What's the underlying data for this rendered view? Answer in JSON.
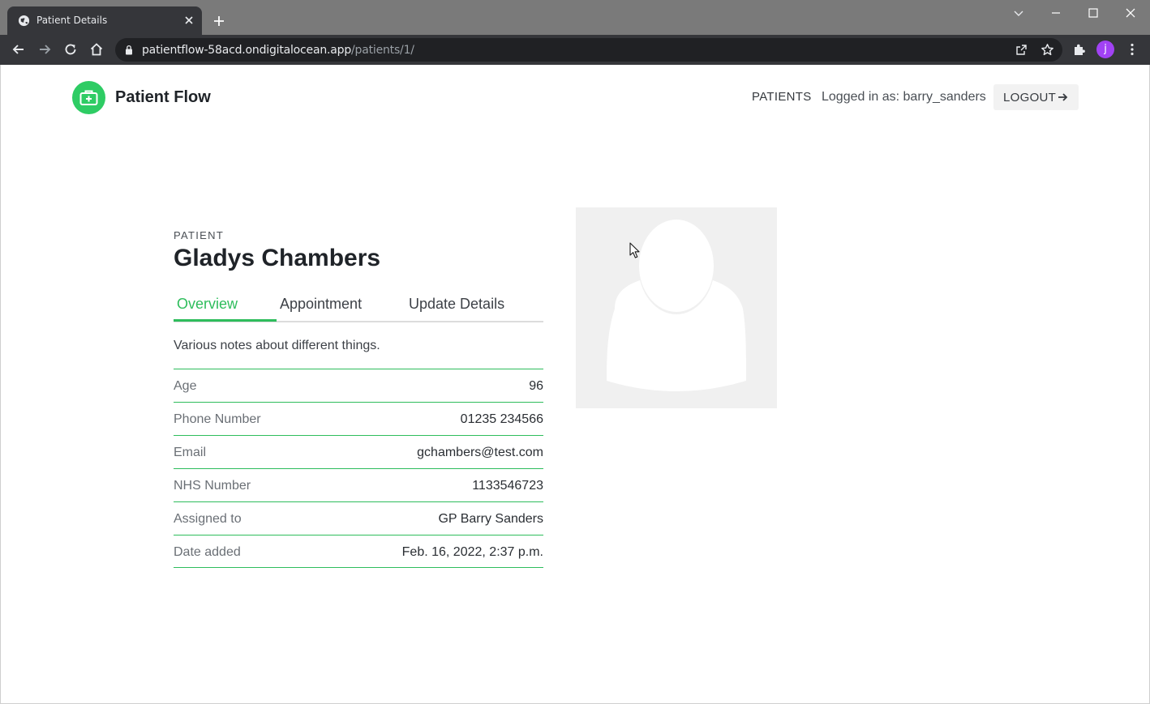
{
  "browser": {
    "tab_title": "Patient Details",
    "url_host": "patientflow-58acd.ondigitalocean.app",
    "url_path": "/patients/1/",
    "profile_initial": "j"
  },
  "header": {
    "brand_name": "Patient Flow",
    "nav_patients": "PATIENTS",
    "logged_in_text": "Logged in as: barry_sanders",
    "logout_label": "LOGOUT"
  },
  "patient": {
    "eyebrow": "PATIENT",
    "name": "Gladys Chambers",
    "tabs": [
      {
        "label": "Overview",
        "active": true
      },
      {
        "label": "Appointment",
        "active": false
      },
      {
        "label": "Update Details",
        "active": false
      }
    ],
    "notes": "Various notes about different things.",
    "fields": [
      {
        "label": "Age",
        "value": "96"
      },
      {
        "label": "Phone Number",
        "value": "01235 234566"
      },
      {
        "label": "Email",
        "value": "gchambers@test.com"
      },
      {
        "label": "NHS Number",
        "value": "1133546723"
      },
      {
        "label": "Assigned to",
        "value": "GP Barry Sanders"
      },
      {
        "label": "Date added",
        "value": "Feb. 16, 2022, 2:37 p.m."
      }
    ]
  },
  "colors": {
    "accent": "#2ebd5c",
    "brand_logo": "#2ecc64",
    "avatar_placeholder_bg": "#f0f0f0"
  }
}
